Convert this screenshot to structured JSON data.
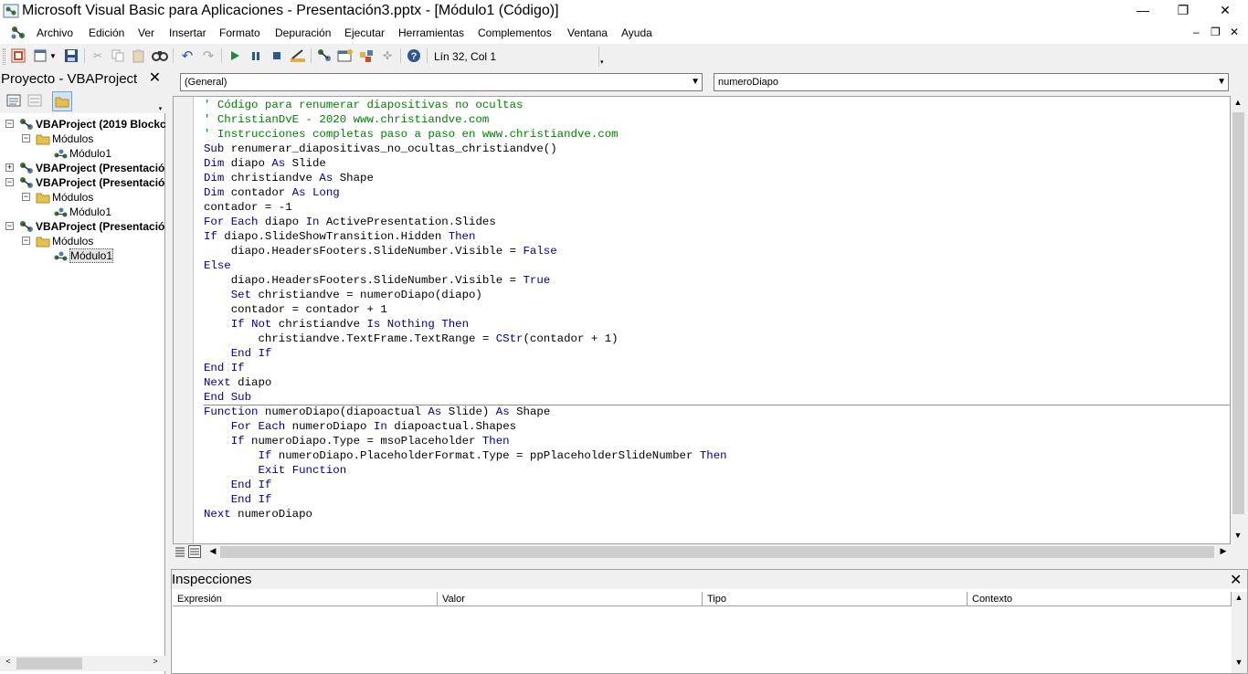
{
  "window": {
    "title": "Microsoft Visual Basic para Aplicaciones - Presentación3.pptx - [Módulo1 (Código)]",
    "minimize_glyph": "—",
    "maximize_glyph": "❐",
    "close_glyph": "✕"
  },
  "menu": {
    "items": [
      "Archivo",
      "Edición",
      "Ver",
      "Insertar",
      "Formato",
      "Depuración",
      "Ejecutar",
      "Herramientas",
      "Complementos",
      "Ventana",
      "Ayuda"
    ],
    "mdi_minimize": "–",
    "mdi_restore": "❐",
    "mdi_close": "✕"
  },
  "toolbar": {
    "cursor_position": "Lín 32, Col 1",
    "icons": [
      "powerpoint-icon",
      "insert-module-icon",
      "save-icon",
      "cut-icon",
      "copy-icon",
      "paste-icon",
      "find-icon",
      "undo-icon",
      "redo-icon",
      "run-icon",
      "break-icon",
      "reset-icon",
      "design-mode-icon",
      "project-explorer-icon",
      "properties-icon",
      "object-browser-icon",
      "toolbox-icon",
      "help-icon"
    ]
  },
  "project": {
    "title": "Proyecto - VBAProject",
    "close_glyph": "✕",
    "tree": [
      {
        "label": "VBAProject (2019 Blockc",
        "level": 0,
        "bold": true,
        "expanded": true
      },
      {
        "label": "Módulos",
        "level": 1,
        "bold": false,
        "expanded": true
      },
      {
        "label": "Módulo1",
        "level": 2,
        "bold": false
      },
      {
        "label": "VBAProject (Presentació",
        "level": 0,
        "bold": true,
        "expanded": false
      },
      {
        "label": "VBAProject (Presentació",
        "level": 0,
        "bold": true,
        "expanded": true
      },
      {
        "label": "Módulos",
        "level": 1,
        "bold": false,
        "expanded": true
      },
      {
        "label": "Módulo1",
        "level": 2,
        "bold": false
      },
      {
        "label": "VBAProject (Presentació",
        "level": 0,
        "bold": true,
        "expanded": true
      },
      {
        "label": "Módulos",
        "level": 1,
        "bold": false,
        "expanded": true
      },
      {
        "label": "Módulo1",
        "level": 2,
        "bold": false,
        "selected": true
      }
    ]
  },
  "code": {
    "object_combo": "(General)",
    "procedure_combo": "numeroDiapo",
    "lines": [
      [
        {
          "t": "' Código para renumerar diapositivas no ocultas",
          "c": "cm"
        }
      ],
      [
        {
          "t": "' ChristianDvE - 2020 www.christiandve.com",
          "c": "cm"
        }
      ],
      [
        {
          "t": "' Instrucciones completas paso a paso en www.christiandve.com",
          "c": "cm"
        }
      ],
      [
        {
          "t": "Sub",
          "c": "kw"
        },
        {
          "t": " renumerar_diapositivas_no_ocultas_christiandve()"
        }
      ],
      [
        {
          "t": "Dim",
          "c": "kw"
        },
        {
          "t": " diapo "
        },
        {
          "t": "As",
          "c": "kw"
        },
        {
          "t": " Slide"
        }
      ],
      [
        {
          "t": "Dim",
          "c": "kw"
        },
        {
          "t": " christiandve "
        },
        {
          "t": "As",
          "c": "kw"
        },
        {
          "t": " Shape"
        }
      ],
      [
        {
          "t": "Dim",
          "c": "kw"
        },
        {
          "t": " contador "
        },
        {
          "t": "As",
          "c": "kw"
        },
        {
          "t": " "
        },
        {
          "t": "Long",
          "c": "kw"
        }
      ],
      [
        {
          "t": "contador = -1"
        }
      ],
      [
        {
          "t": "For",
          "c": "kw"
        },
        {
          "t": " "
        },
        {
          "t": "Each",
          "c": "kw"
        },
        {
          "t": " diapo "
        },
        {
          "t": "In",
          "c": "kw"
        },
        {
          "t": " ActivePresentation.Slides"
        }
      ],
      [
        {
          "t": "If",
          "c": "kw"
        },
        {
          "t": " diapo.SlideShowTransition.Hidden "
        },
        {
          "t": "Then",
          "c": "kw"
        }
      ],
      [
        {
          "t": "    diapo.HeadersFooters.SlideNumber.Visible = "
        },
        {
          "t": "False",
          "c": "kw"
        }
      ],
      [
        {
          "t": "Else",
          "c": "kw"
        }
      ],
      [
        {
          "t": "    diapo.HeadersFooters.SlideNumber.Visible = "
        },
        {
          "t": "True",
          "c": "kw"
        }
      ],
      [
        {
          "t": "    "
        },
        {
          "t": "Set",
          "c": "kw"
        },
        {
          "t": " christiandve = numeroDiapo(diapo)"
        }
      ],
      [
        {
          "t": "    contador = contador + 1"
        }
      ],
      [
        {
          "t": "    "
        },
        {
          "t": "If",
          "c": "kw"
        },
        {
          "t": " "
        },
        {
          "t": "Not",
          "c": "kw"
        },
        {
          "t": " christiandve "
        },
        {
          "t": "Is",
          "c": "kw"
        },
        {
          "t": " "
        },
        {
          "t": "Nothing",
          "c": "kw"
        },
        {
          "t": " "
        },
        {
          "t": "Then",
          "c": "kw"
        }
      ],
      [
        {
          "t": "        christiandve.TextFrame.TextRange = "
        },
        {
          "t": "CStr",
          "c": "kw"
        },
        {
          "t": "(contador + 1)"
        }
      ],
      [
        {
          "t": "    "
        },
        {
          "t": "End",
          "c": "kw"
        },
        {
          "t": " "
        },
        {
          "t": "If",
          "c": "kw"
        }
      ],
      [
        {
          "t": "End",
          "c": "kw"
        },
        {
          "t": " "
        },
        {
          "t": "If",
          "c": "kw"
        }
      ],
      [
        {
          "t": "Next",
          "c": "kw"
        },
        {
          "t": " diapo"
        }
      ],
      [
        {
          "t": "End",
          "c": "kw"
        },
        {
          "t": " "
        },
        {
          "t": "Sub",
          "c": "kw"
        }
      ],
      [
        {
          "t": "Function",
          "c": "kw"
        },
        {
          "t": " numeroDiapo(diapoactual "
        },
        {
          "t": "As",
          "c": "kw"
        },
        {
          "t": " Slide) "
        },
        {
          "t": "As",
          "c": "kw"
        },
        {
          "t": " Shape"
        }
      ],
      [
        {
          "t": "    "
        },
        {
          "t": "For",
          "c": "kw"
        },
        {
          "t": " "
        },
        {
          "t": "Each",
          "c": "kw"
        },
        {
          "t": " numeroDiapo "
        },
        {
          "t": "In",
          "c": "kw"
        },
        {
          "t": " diapoactual.Shapes"
        }
      ],
      [
        {
          "t": "    "
        },
        {
          "t": "If",
          "c": "kw"
        },
        {
          "t": " numeroDiapo.Type = msoPlaceholder "
        },
        {
          "t": "Then",
          "c": "kw"
        }
      ],
      [
        {
          "t": "        "
        },
        {
          "t": "If",
          "c": "kw"
        },
        {
          "t": " numeroDiapo.PlaceholderFormat.Type = ppPlaceholderSlideNumber "
        },
        {
          "t": "Then",
          "c": "kw"
        }
      ],
      [
        {
          "t": "        "
        },
        {
          "t": "Exit",
          "c": "kw"
        },
        {
          "t": " "
        },
        {
          "t": "Function",
          "c": "kw"
        }
      ],
      [
        {
          "t": "    "
        },
        {
          "t": "End",
          "c": "kw"
        },
        {
          "t": " "
        },
        {
          "t": "If",
          "c": "kw"
        }
      ],
      [
        {
          "t": "    "
        },
        {
          "t": "End",
          "c": "kw"
        },
        {
          "t": " "
        },
        {
          "t": "If",
          "c": "kw"
        }
      ],
      [
        {
          "t": "Next",
          "c": "kw"
        },
        {
          "t": " numeroDiapo"
        }
      ]
    ]
  },
  "watch": {
    "title": "Inspecciones",
    "close_glyph": "✕",
    "columns": [
      "Expresión",
      "Valor",
      "Tipo",
      "Contexto"
    ]
  },
  "colors": {
    "keyword": "#00008b",
    "comment": "#008000"
  }
}
